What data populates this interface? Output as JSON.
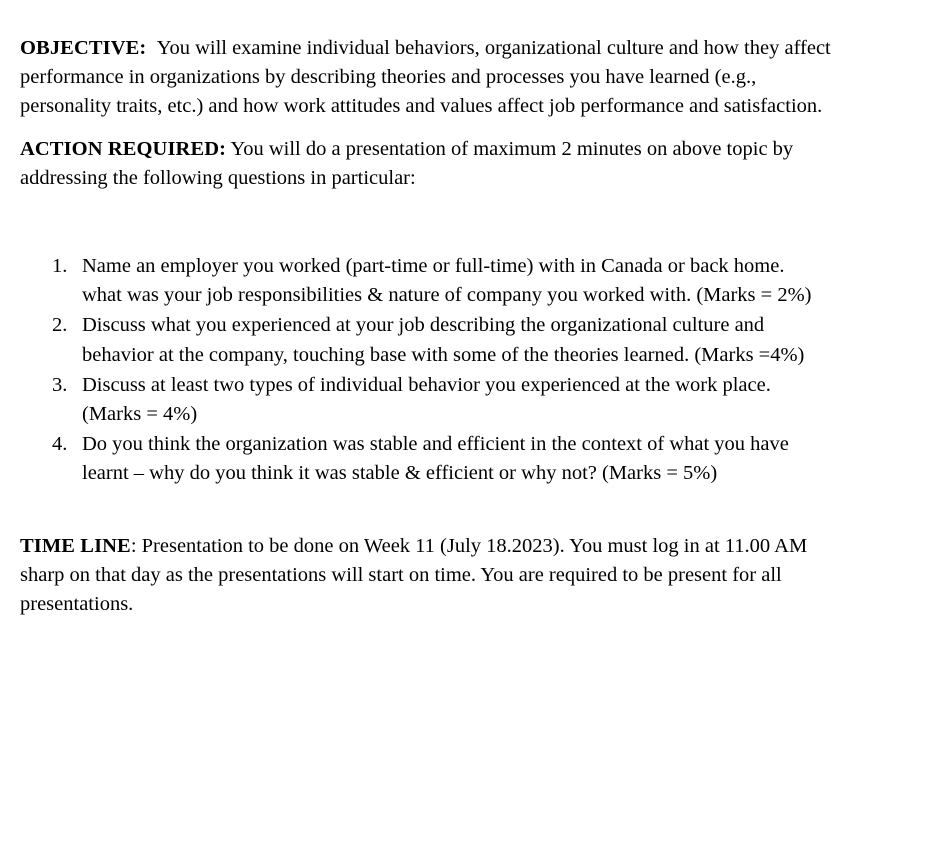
{
  "document": {
    "background_color": "#ffffff",
    "text_color": "#000000",
    "sections": {
      "objective": {
        "lead_label": "OBJECTIVE:",
        "body": "You will examine individual behaviors, organizational culture and how they affect performance in organizations by describing theories and processes you have learned (e.g., personality traits, etc.) and how work attitudes and values affect job performance and satisfaction."
      },
      "action_required": {
        "lead_label": "ACTION REQUIRED:",
        "body": "You will do a presentation of maximum 2 minutes on above topic by addressing the following questions in particular:"
      },
      "questions": [
        {
          "number": "1.",
          "text": "Name an employer you worked (part-time or full-time) with in Canada or back home. what was your job responsibilities & nature of company you worked with. (Marks = 2%)",
          "marks": "2%"
        },
        {
          "number": "2.",
          "text": "Discuss what you experienced at your job describing the organizational culture and behavior at the company, touching base with some of the theories learned. (Marks =4%)",
          "marks": "4%"
        },
        {
          "number": "3.",
          "text": "Discuss at least two types of individual behavior you experienced at the work place. (Marks = 4%)",
          "marks": "4%"
        },
        {
          "number": "4.",
          "text": "Do you think the organization was stable and efficient in the context of what you have learnt – why do you think it was stable & efficient or why not? (Marks = 5%)",
          "marks": "5%"
        }
      ],
      "time_line": {
        "lead_label": "TIME LINE",
        "body": ": Presentation to be done on Week 11 (July 18.2023). You must log in at 11.00 AM sharp on that day as the presentations will start on time. You are required to be present for all presentations.",
        "week": "Week 11",
        "date": "July 18.2023",
        "time": "11.00 AM"
      }
    }
  }
}
